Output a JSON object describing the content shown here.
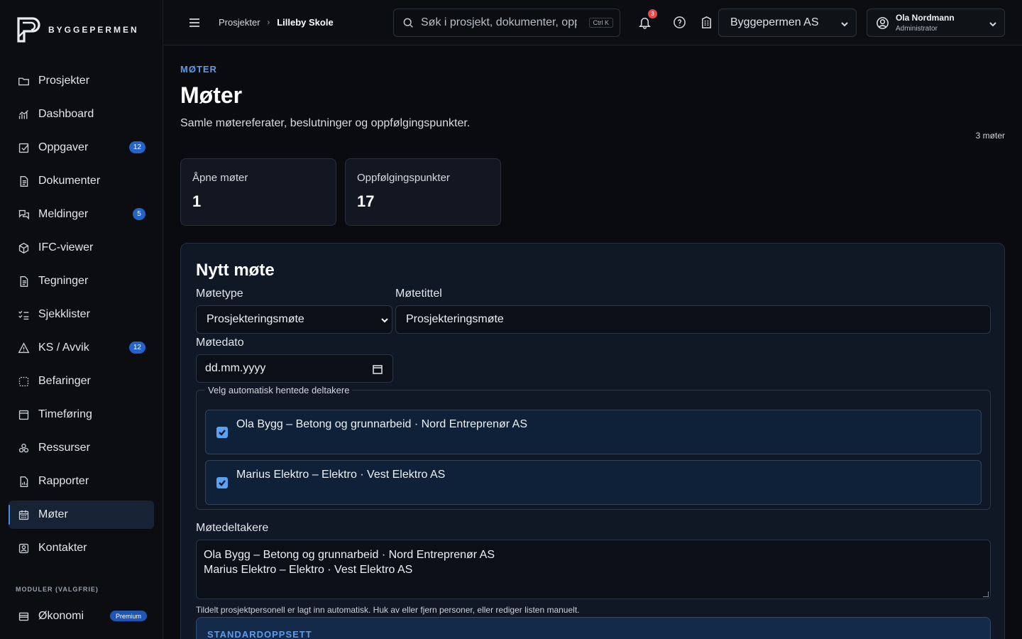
{
  "brand": {
    "name": "BYGGEPERMEN"
  },
  "sidebar": {
    "items": [
      {
        "label": "Prosjekter",
        "icon": "folder-icon"
      },
      {
        "label": "Dashboard",
        "icon": "chart-icon"
      },
      {
        "label": "Oppgaver",
        "icon": "checkbox-icon",
        "badge": "12"
      },
      {
        "label": "Dokumenter",
        "icon": "document-icon"
      },
      {
        "label": "Meldinger",
        "icon": "messages-icon",
        "badge": "5"
      },
      {
        "label": "IFC-viewer",
        "icon": "cube-icon"
      },
      {
        "label": "Tegninger",
        "icon": "document-icon"
      },
      {
        "label": "Sjekklister",
        "icon": "checklist-icon"
      },
      {
        "label": "KS / Avvik",
        "icon": "warning-icon",
        "badge": "12"
      },
      {
        "label": "Befaringer",
        "icon": "scan-icon"
      },
      {
        "label": "Timeføring",
        "icon": "calendar-icon"
      },
      {
        "label": "Ressurser",
        "icon": "cluster-icon"
      },
      {
        "label": "Rapporter",
        "icon": "report-icon"
      },
      {
        "label": "Møter",
        "icon": "calendar-grid-icon",
        "active": true
      },
      {
        "label": "Kontakter",
        "icon": "contact-icon"
      }
    ],
    "modules_label": "MODULER (VALGFRIE)",
    "modules": [
      {
        "label": "Økonomi",
        "icon": "wallet-icon",
        "badge": "Premium"
      }
    ]
  },
  "topbar": {
    "breadcrumb": [
      "Prosjekter",
      "Lilleby Skole"
    ],
    "search_placeholder": "Søk i prosjekt, dokumenter, oppgaver",
    "shortcut": "Ctrl K",
    "notifications": "3",
    "company": "Byggepermen AS",
    "user": {
      "name": "Ola Nordmann",
      "role": "Administrator"
    }
  },
  "page": {
    "eyebrow": "MØTER",
    "title": "Møter",
    "subtitle": "Samle møtereferater, beslutninger og oppfølgingspunkter.",
    "count": "3 møter",
    "stats": [
      {
        "label": "Åpne møter",
        "value": "1"
      },
      {
        "label": "Oppfølgingspunkter",
        "value": "17"
      }
    ]
  },
  "form": {
    "title": "Nytt møte",
    "type_label": "Møtetype",
    "type_value": "Prosjekteringsmøte",
    "title_label": "Møtetittel",
    "title_value": "Prosjekteringsmøte",
    "date_label": "Møtedato",
    "date_placeholder": "dd.mm.yyyy",
    "participants_legend": "Velg automatisk hentede deltakere",
    "participants": [
      {
        "text": "Ola Bygg – Betong og grunnarbeid · Nord Entreprenør AS",
        "checked": true
      },
      {
        "text": "Marius Elektro – Elektro · Vest Elektro AS",
        "checked": true
      }
    ],
    "attendees_label": "Møtedeltakere",
    "attendees_lines": [
      "Ola Bygg – Betong og grunnarbeid · Nord Entreprenør AS",
      "Marius Elektro – Elektro · Vest Elektro AS"
    ],
    "hint": "Tildelt prosjektpersonell er lagt inn automatisk. Huk av eller fjern personer, eller rediger listen manuelt.",
    "standard_label": "STANDARDOPPSETT"
  }
}
